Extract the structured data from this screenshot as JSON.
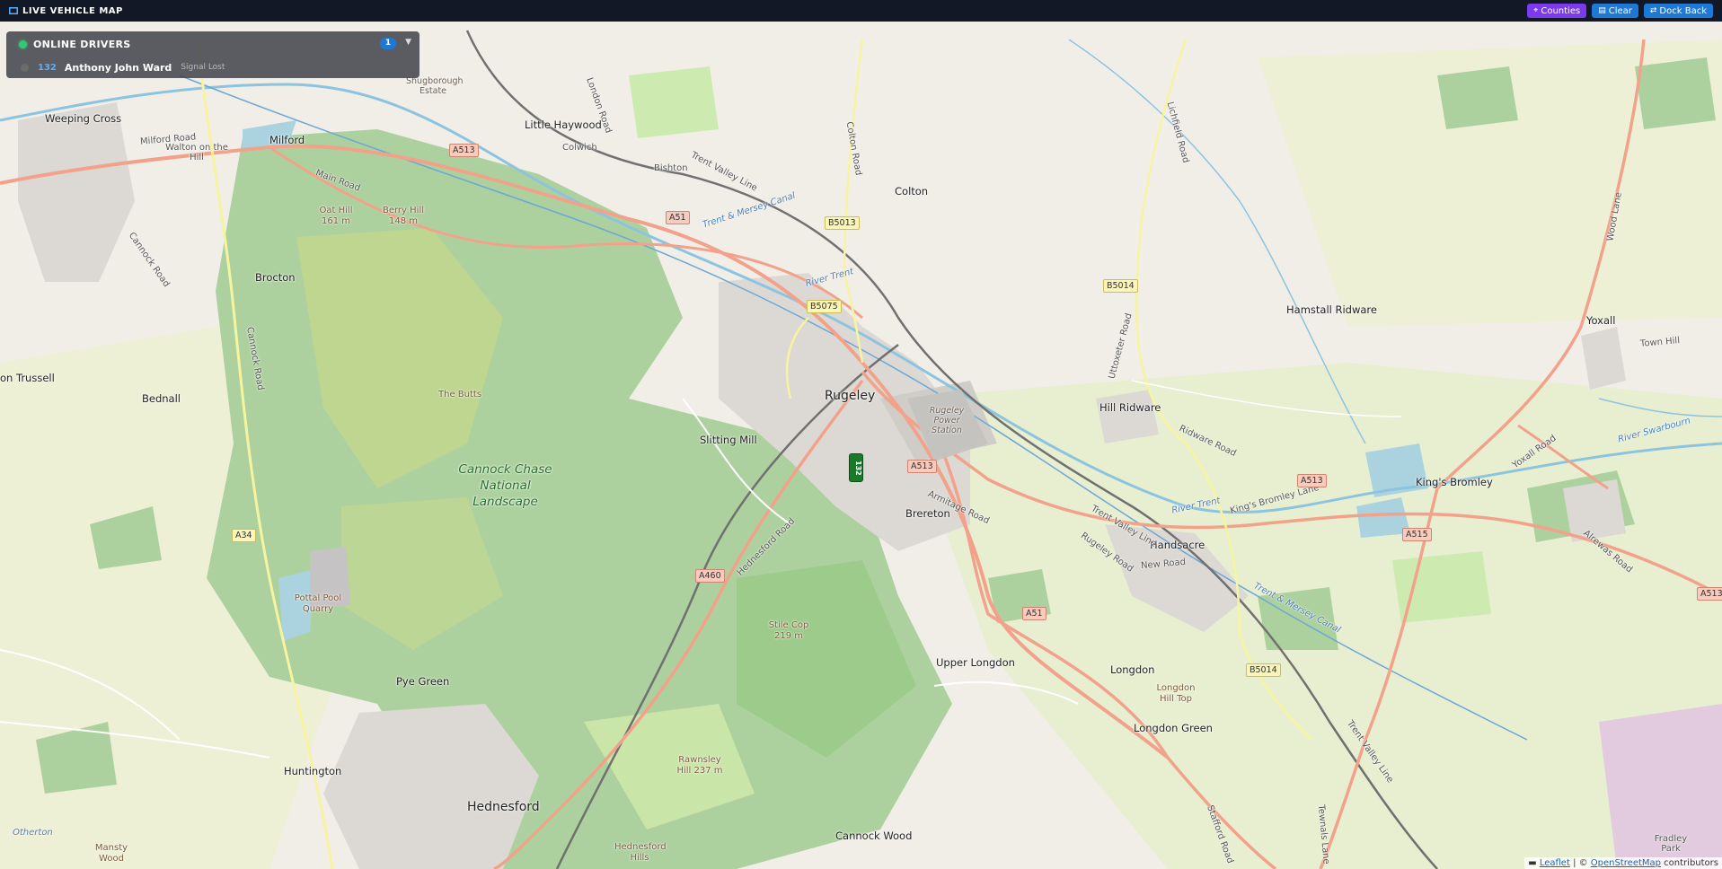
{
  "topbar": {
    "title": "LIVE VEHICLE MAP",
    "buttons": {
      "counties": "Counties",
      "clear": "Clear",
      "dock_back": "Dock Back"
    }
  },
  "drivers_panel": {
    "title": "ONLINE DRIVERS",
    "count": "1",
    "drivers": [
      {
        "id": "132",
        "name": "Anthony John Ward",
        "status": "Signal Lost"
      }
    ]
  },
  "vehicle_marker": {
    "label": "132"
  },
  "attribution": {
    "leaflet": "Leaflet",
    "sep": " | © ",
    "osm": "OpenStreetMap",
    "suffix": " contributors"
  },
  "map_labels": {
    "rugeley": "Rugeley",
    "hednesford": "Hednesford",
    "brereton": "Brereton",
    "colton": "Colton",
    "hamstall_ridware": "Hamstall Ridware",
    "yoxall": "Yoxall",
    "hill_ridware": "Hill Ridware",
    "kings_bromley": "King's Bromley",
    "handsacre": "Handsacre",
    "longdon": "Longdon",
    "longdon_green": "Longdon Green",
    "upper_longdon": "Upper Longdon",
    "cannock_wood": "Cannock Wood",
    "pye_green": "Pye Green",
    "huntington": "Huntington",
    "slitting_mill": "Slitting Mill",
    "brocton": "Brocton",
    "bednall": "Bednall",
    "on_trussell": "on Trussell",
    "weeping_cross": "Weeping Cross",
    "walton_on_the_hill": "Walton on the Hill",
    "milford": "Milford",
    "little_haywood": "Little Haywood",
    "colwich": "Colwich",
    "bishton": "Bishton",
    "shugborough": "Shugborough Estate",
    "cannock_chase": "Cannock Chase National Landscape",
    "oat_hill": "Oat Hill 161 m",
    "berry_hill": "Berry Hill 148 m",
    "the_butts": "The Butts",
    "pottal_pool": "Pottal Pool Quarry",
    "stile_cop": "Stile Cop 219 m",
    "rawnsley_hill": "Rawnsley Hill 237 m",
    "hednesford_hills": "Hednesford Hills",
    "longdon_hill_top": "Longdon Hill Top",
    "rugeley_power": "Rugeley Power Station",
    "otherton": "Otherton",
    "mansty_wood": "Mansty Wood",
    "fradley_park": "Fradley Park",
    "trent_valley_line": "Trent Valley Line",
    "trent_mersey": "Trent & Mersey Canal",
    "river_trent": "River Trent",
    "river_swarbourn": "River Swarbourn",
    "cannock_road": "Cannock Road",
    "main_road": "Main Road",
    "milford_road": "Milford Road",
    "london_road": "London Road",
    "colton_road": "Colton Road",
    "lichfield_road": "Lichfield Road",
    "uttoxeter_road": "Uttoxeter Road",
    "ridware_road": "Ridware Road",
    "rugeley_road": "Rugeley Road",
    "hednesford_road": "Hednesford Road",
    "armitage_road": "Armitage Road",
    "new_road": "New Road",
    "kings_bromley_lane": "King's Bromley Lane",
    "yoxall_road": "Yoxall Road",
    "wood_lane": "Wood Lane",
    "alrewas_road": "Alrewas Road",
    "town_hill": "Town Hill",
    "stafford_road": "Stafford Road",
    "tewnals_lane": "Tewnals Lane"
  },
  "road_shields": {
    "a513_1": "A513",
    "a51_1": "A51",
    "b5013": "B5013",
    "b5075": "B5075",
    "b5014_1": "B5014",
    "a513_2": "A513",
    "a513_3": "A513",
    "a515": "A515",
    "a34": "A34",
    "a460": "A460",
    "a51_2": "A51",
    "b5014_2": "B5014",
    "a513_4": "A513"
  },
  "colors": {
    "forest": "#add19e",
    "forest_dark": "#9ccb8b",
    "urban": "#dcd9d4",
    "farmland": "#eef0d5",
    "road_primary": "#f2a28a",
    "road_secondary": "#f7f4a0",
    "water": "#aad3df"
  }
}
